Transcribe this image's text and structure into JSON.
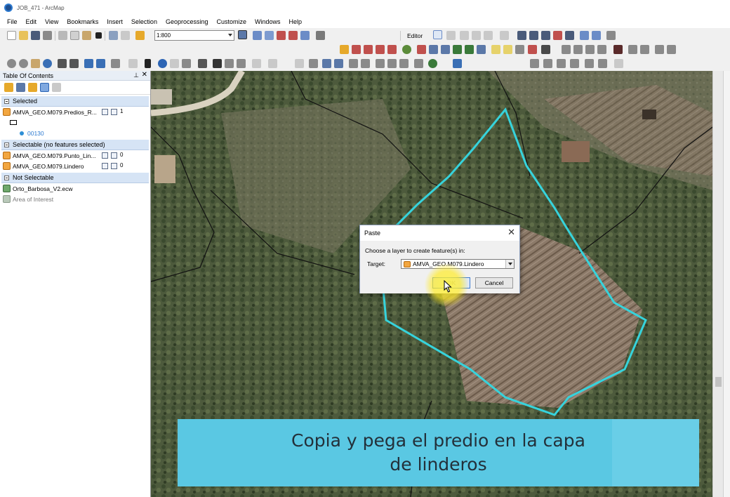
{
  "window": {
    "title": "JOB_471 - ArcMap"
  },
  "menu": [
    "File",
    "Edit",
    "View",
    "Bookmarks",
    "Insert",
    "Selection",
    "Geoprocessing",
    "Customize",
    "Windows",
    "Help"
  ],
  "toolbar": {
    "scale": "1:800",
    "editor_label": "Editor"
  },
  "toc": {
    "title": "Table Of Contents",
    "groups": [
      {
        "label": "Selected",
        "layers": [
          {
            "name": "AMVA_GEO.M079.Predios_R...",
            "count": "1"
          }
        ],
        "legend_value": "00130"
      },
      {
        "label": "Selectable (no features selected)",
        "layers": [
          {
            "name": "AMVA_GEO.M079.Punto_Lin...",
            "count": "0"
          },
          {
            "name": "AMVA_GEO.M079.Lindero",
            "count": "0"
          }
        ]
      },
      {
        "label": "Not Selectable",
        "layers": [
          {
            "name": "Orto_Barbosa_V2.ecw"
          },
          {
            "name": "Area of Interest"
          }
        ]
      }
    ]
  },
  "dialog": {
    "title": "Paste",
    "prompt": "Choose a layer to create feature(s) in:",
    "target_label": "Target:",
    "target_value": "AMVA_GEO.M079.Lindero",
    "ok_label": "OK",
    "cancel_label": "Cancel"
  },
  "caption": {
    "line1": "Copia y pega el predio en la capa",
    "line2": "de linderos"
  },
  "colors": {
    "parcel_outline": "#36d3dc",
    "caption_bg": "#5ac8e3",
    "highlight": "#fff23c"
  }
}
